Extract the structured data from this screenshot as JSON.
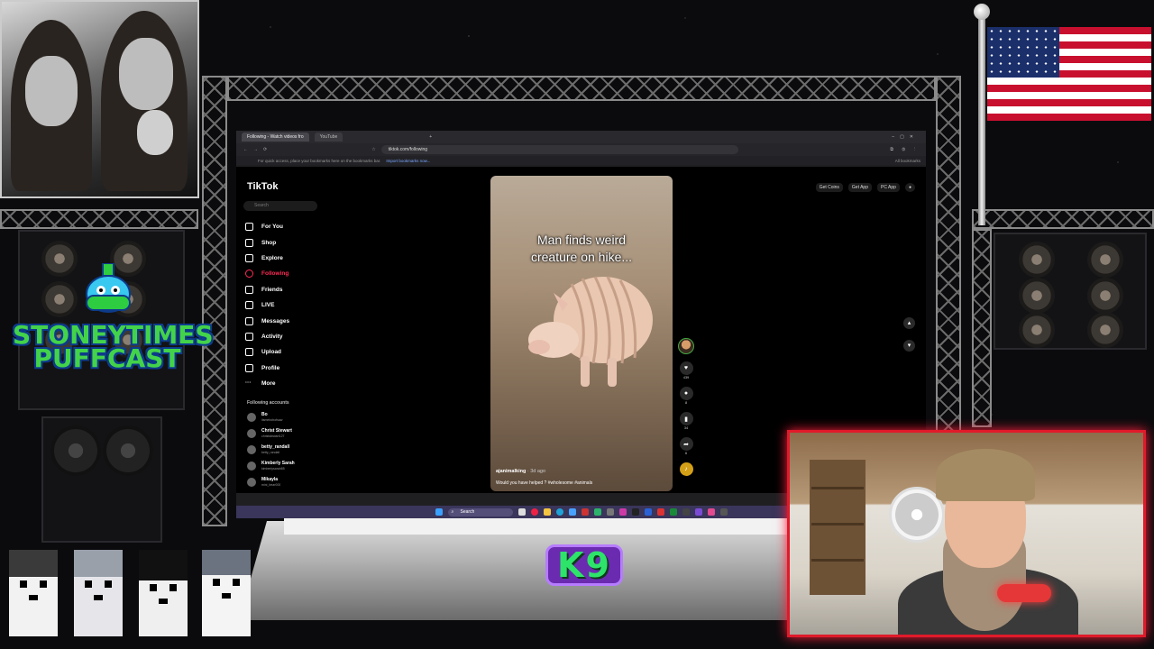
{
  "overlay": {
    "logo_line1": "STONEYTIMES",
    "logo_line2": "PUFFCAST",
    "badge": "K9"
  },
  "browser": {
    "tabs": [
      {
        "label": "Following - Watch videos fro",
        "active": true
      },
      {
        "label": "YouTube",
        "active": false
      }
    ],
    "url": "tiktok.com/following",
    "bookmarks_hint": "For quick access, place your bookmarks here on the bookmarks bar.",
    "bookmarks_link": "Import bookmarks now...",
    "all_bookmarks": "All bookmarks"
  },
  "tiktok": {
    "brand": "TikTok",
    "search_placeholder": "Search",
    "nav": [
      {
        "label": "For You",
        "icon": "home-icon",
        "active": false
      },
      {
        "label": "Shop",
        "icon": "shop-icon",
        "active": false
      },
      {
        "label": "Explore",
        "icon": "compass-icon",
        "active": false
      },
      {
        "label": "Following",
        "icon": "following-icon",
        "active": true
      },
      {
        "label": "Friends",
        "icon": "friends-icon",
        "active": false
      },
      {
        "label": "LIVE",
        "icon": "live-icon",
        "active": false
      },
      {
        "label": "Messages",
        "icon": "messages-icon",
        "active": false
      },
      {
        "label": "Activity",
        "icon": "activity-icon",
        "active": false
      },
      {
        "label": "Upload",
        "icon": "upload-icon",
        "active": false
      },
      {
        "label": "Profile",
        "icon": "profile-icon",
        "active": false
      },
      {
        "label": "More",
        "icon": "more-icon",
        "active": false
      }
    ],
    "following_title": "Following accounts",
    "accounts": [
      {
        "name": "Bo",
        "user": "itsmebobofsaw"
      },
      {
        "name": "Christ Stewart",
        "user": "christstewart127"
      },
      {
        "name": "betty_randall",
        "user": "betty_randall"
      },
      {
        "name": "Kimberly Sarah",
        "user": "kimberlysarah85"
      },
      {
        "name": "Mikayla",
        "user": "mini_bear000"
      }
    ],
    "top_right": [
      "Get Coins",
      "Get App",
      "PC App"
    ],
    "video": {
      "caption_line1": "Man finds weird",
      "caption_line2": "creature on hike...",
      "username": "ajanimalking",
      "time": "· 3d ago",
      "description": "Would you have helped ? #wholesome #animals",
      "likes": "439",
      "comments": "8",
      "saves": "34",
      "shares": "6"
    }
  },
  "taskbar": {
    "search_label": "Search"
  },
  "colors": {
    "tiktok_red": "#fe2c55",
    "logo_green": "#43d34a",
    "cam_border": "#e01a2a",
    "badge_purple": "#6a2bb0"
  }
}
